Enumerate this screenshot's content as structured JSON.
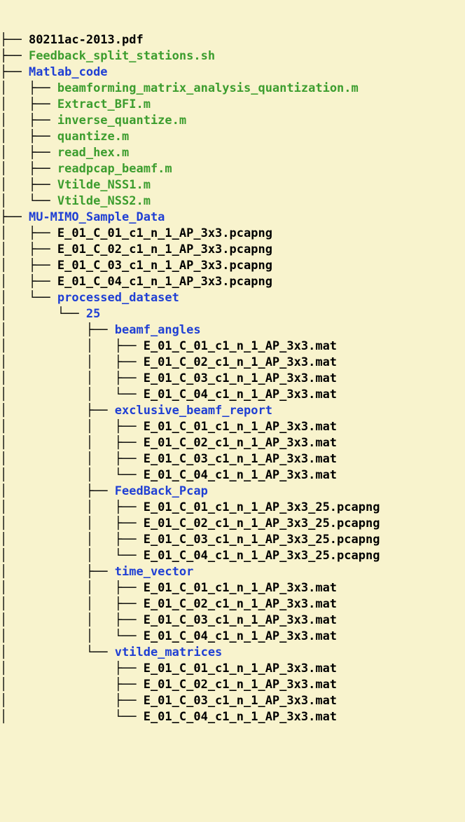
{
  "colors": {
    "bg": "#f8f3cd",
    "file": "#000000",
    "exec": "#3c9d2e",
    "dir": "#1f3fd4"
  },
  "glyphs": {
    "pipe": "│   ",
    "tee": "├── ",
    "ell": "└── ",
    "blank": "    "
  },
  "nodes": [
    {
      "prefix": [
        "tee"
      ],
      "kind": "file",
      "label": "80211ac-2013.pdf"
    },
    {
      "prefix": [
        "tee"
      ],
      "kind": "exec",
      "label": "Feedback_split_stations.sh"
    },
    {
      "prefix": [
        "tee"
      ],
      "kind": "dir",
      "label": "Matlab_code"
    },
    {
      "prefix": [
        "pipe",
        "tee"
      ],
      "kind": "exec",
      "label": "beamforming_matrix_analysis_quantization.m"
    },
    {
      "prefix": [
        "pipe",
        "tee"
      ],
      "kind": "exec",
      "label": "Extract_BFI.m"
    },
    {
      "prefix": [
        "pipe",
        "tee"
      ],
      "kind": "exec",
      "label": "inverse_quantize.m"
    },
    {
      "prefix": [
        "pipe",
        "tee"
      ],
      "kind": "exec",
      "label": "quantize.m"
    },
    {
      "prefix": [
        "pipe",
        "tee"
      ],
      "kind": "exec",
      "label": "read_hex.m"
    },
    {
      "prefix": [
        "pipe",
        "tee"
      ],
      "kind": "exec",
      "label": "readpcap_beamf.m"
    },
    {
      "prefix": [
        "pipe",
        "tee"
      ],
      "kind": "exec",
      "label": "Vtilde_NSS1.m"
    },
    {
      "prefix": [
        "pipe",
        "ell"
      ],
      "kind": "exec",
      "label": "Vtilde_NSS2.m"
    },
    {
      "prefix": [
        "tee"
      ],
      "kind": "dir",
      "label": "MU-MIMO_Sample_Data"
    },
    {
      "prefix": [
        "pipe",
        "tee"
      ],
      "kind": "file",
      "label": "E_01_C_01_c1_n_1_AP_3x3.pcapng"
    },
    {
      "prefix": [
        "pipe",
        "tee"
      ],
      "kind": "file",
      "label": "E_01_C_02_c1_n_1_AP_3x3.pcapng"
    },
    {
      "prefix": [
        "pipe",
        "tee"
      ],
      "kind": "file",
      "label": "E_01_C_03_c1_n_1_AP_3x3.pcapng"
    },
    {
      "prefix": [
        "pipe",
        "tee"
      ],
      "kind": "file",
      "label": "E_01_C_04_c1_n_1_AP_3x3.pcapng"
    },
    {
      "prefix": [
        "pipe",
        "ell"
      ],
      "kind": "dir",
      "label": "processed_dataset"
    },
    {
      "prefix": [
        "pipe",
        "blank",
        "ell"
      ],
      "kind": "dir",
      "label": "25"
    },
    {
      "prefix": [
        "pipe",
        "blank",
        "blank",
        "tee"
      ],
      "kind": "dir",
      "label": "beamf_angles"
    },
    {
      "prefix": [
        "pipe",
        "blank",
        "blank",
        "pipe",
        "tee"
      ],
      "kind": "file",
      "label": "E_01_C_01_c1_n_1_AP_3x3.mat"
    },
    {
      "prefix": [
        "pipe",
        "blank",
        "blank",
        "pipe",
        "tee"
      ],
      "kind": "file",
      "label": "E_01_C_02_c1_n_1_AP_3x3.mat"
    },
    {
      "prefix": [
        "pipe",
        "blank",
        "blank",
        "pipe",
        "tee"
      ],
      "kind": "file",
      "label": "E_01_C_03_c1_n_1_AP_3x3.mat"
    },
    {
      "prefix": [
        "pipe",
        "blank",
        "blank",
        "pipe",
        "ell"
      ],
      "kind": "file",
      "label": "E_01_C_04_c1_n_1_AP_3x3.mat"
    },
    {
      "prefix": [
        "pipe",
        "blank",
        "blank",
        "tee"
      ],
      "kind": "dir",
      "label": "exclusive_beamf_report"
    },
    {
      "prefix": [
        "pipe",
        "blank",
        "blank",
        "pipe",
        "tee"
      ],
      "kind": "file",
      "label": "E_01_C_01_c1_n_1_AP_3x3.mat"
    },
    {
      "prefix": [
        "pipe",
        "blank",
        "blank",
        "pipe",
        "tee"
      ],
      "kind": "file",
      "label": "E_01_C_02_c1_n_1_AP_3x3.mat"
    },
    {
      "prefix": [
        "pipe",
        "blank",
        "blank",
        "pipe",
        "tee"
      ],
      "kind": "file",
      "label": "E_01_C_03_c1_n_1_AP_3x3.mat"
    },
    {
      "prefix": [
        "pipe",
        "blank",
        "blank",
        "pipe",
        "ell"
      ],
      "kind": "file",
      "label": "E_01_C_04_c1_n_1_AP_3x3.mat"
    },
    {
      "prefix": [
        "pipe",
        "blank",
        "blank",
        "tee"
      ],
      "kind": "dir",
      "label": "FeedBack_Pcap"
    },
    {
      "prefix": [
        "pipe",
        "blank",
        "blank",
        "pipe",
        "tee"
      ],
      "kind": "file",
      "label": "E_01_C_01_c1_n_1_AP_3x3_25.pcapng"
    },
    {
      "prefix": [
        "pipe",
        "blank",
        "blank",
        "pipe",
        "tee"
      ],
      "kind": "file",
      "label": "E_01_C_02_c1_n_1_AP_3x3_25.pcapng"
    },
    {
      "prefix": [
        "pipe",
        "blank",
        "blank",
        "pipe",
        "tee"
      ],
      "kind": "file",
      "label": "E_01_C_03_c1_n_1_AP_3x3_25.pcapng"
    },
    {
      "prefix": [
        "pipe",
        "blank",
        "blank",
        "pipe",
        "ell"
      ],
      "kind": "file",
      "label": "E_01_C_04_c1_n_1_AP_3x3_25.pcapng"
    },
    {
      "prefix": [
        "pipe",
        "blank",
        "blank",
        "tee"
      ],
      "kind": "dir",
      "label": "time_vector"
    },
    {
      "prefix": [
        "pipe",
        "blank",
        "blank",
        "pipe",
        "tee"
      ],
      "kind": "file",
      "label": "E_01_C_01_c1_n_1_AP_3x3.mat"
    },
    {
      "prefix": [
        "pipe",
        "blank",
        "blank",
        "pipe",
        "tee"
      ],
      "kind": "file",
      "label": "E_01_C_02_c1_n_1_AP_3x3.mat"
    },
    {
      "prefix": [
        "pipe",
        "blank",
        "blank",
        "pipe",
        "tee"
      ],
      "kind": "file",
      "label": "E_01_C_03_c1_n_1_AP_3x3.mat"
    },
    {
      "prefix": [
        "pipe",
        "blank",
        "blank",
        "pipe",
        "ell"
      ],
      "kind": "file",
      "label": "E_01_C_04_c1_n_1_AP_3x3.mat"
    },
    {
      "prefix": [
        "pipe",
        "blank",
        "blank",
        "ell"
      ],
      "kind": "dir",
      "label": "vtilde_matrices"
    },
    {
      "prefix": [
        "pipe",
        "blank",
        "blank",
        "blank",
        "tee"
      ],
      "kind": "file",
      "label": "E_01_C_01_c1_n_1_AP_3x3.mat"
    },
    {
      "prefix": [
        "pipe",
        "blank",
        "blank",
        "blank",
        "tee"
      ],
      "kind": "file",
      "label": "E_01_C_02_c1_n_1_AP_3x3.mat"
    },
    {
      "prefix": [
        "pipe",
        "blank",
        "blank",
        "blank",
        "tee"
      ],
      "kind": "file",
      "label": "E_01_C_03_c1_n_1_AP_3x3.mat"
    },
    {
      "prefix": [
        "pipe",
        "blank",
        "blank",
        "blank",
        "ell"
      ],
      "kind": "file",
      "label": "E_01_C_04_c1_n_1_AP_3x3.mat"
    }
  ]
}
